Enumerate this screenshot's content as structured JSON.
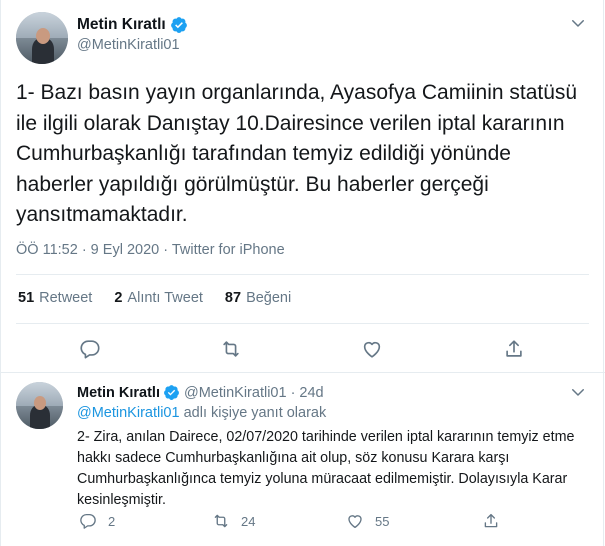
{
  "main_tweet": {
    "display_name": "Metin Kıratlı",
    "handle": "@MetinKiratli01",
    "text": "1- Bazı basın yayın organlarında, Ayasofya Camiinin statüsü ile ilgili olarak Danıştay 10.Dairesince verilen iptal kararının Cumhurbaşkanlığı tarafından temyiz edildiği yönünde haberler yapıldığı görülmüştür. Bu haberler gerçeği yansıtmamaktadır.",
    "meta": "ÖÖ 11:52 · 9 Eyl 2020 · Twitter for iPhone",
    "stats": {
      "retweets_count": "51",
      "retweets_label": "Retweet",
      "quotes_count": "2",
      "quotes_label": "Alıntı Tweet",
      "likes_count": "87",
      "likes_label": "Beğeni"
    },
    "icons": [
      "reply-icon",
      "retweet-icon",
      "like-icon",
      "share-icon"
    ]
  },
  "reply_tweet": {
    "display_name": "Metin Kıratlı",
    "handle_time": "@MetinKiratli01 · 24d",
    "replying_mention": "@MetinKiratli01",
    "replying_suffix": " adlı kişiye yanıt olarak",
    "text": "2- Zira, anılan Dairece, 02/07/2020 tarihinde verilen iptal kararının temyiz etme hakkı sadece Cumhurbaşkanlığına ait olup, söz konusu Karara karşı Cumhurbaşkanlığınca temyiz yoluna müracaat edilmemiştir. Dolayısıyla Karar kesinleşmiştir.",
    "replies": "2",
    "retweets": "24",
    "likes": "55"
  },
  "colors": {
    "accent": "#1da1f2",
    "secondary_text": "#657786",
    "divider": "#e6ecf0"
  }
}
